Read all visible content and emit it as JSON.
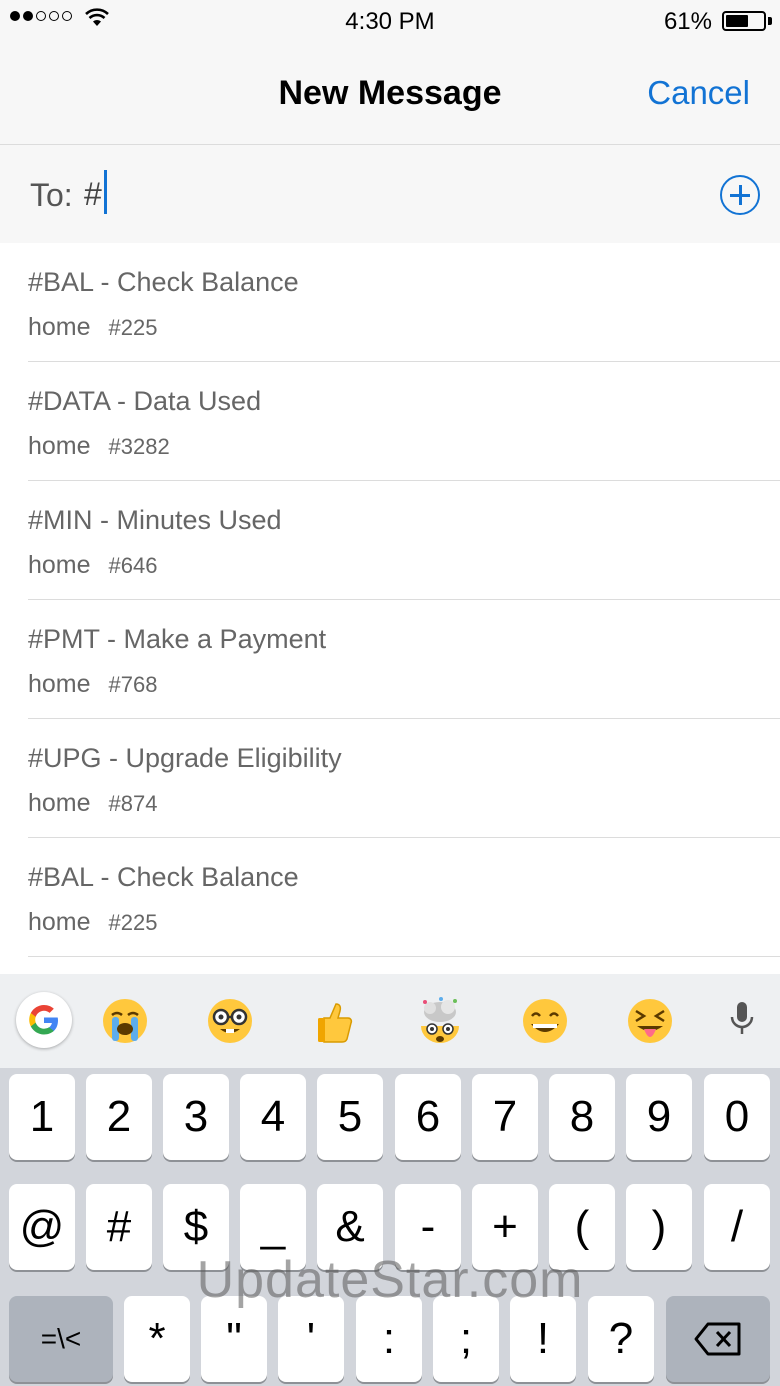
{
  "status": {
    "time": "4:30 PM",
    "battery": "61%"
  },
  "nav": {
    "title": "New Message",
    "cancel": "Cancel"
  },
  "to": {
    "label": "To:",
    "value": "#"
  },
  "contacts": [
    {
      "name": "#BAL - Check Balance",
      "type": "home",
      "number": "#225"
    },
    {
      "name": "#DATA - Data Used",
      "type": "home",
      "number": "#3282"
    },
    {
      "name": "#MIN - Minutes Used",
      "type": "home",
      "number": "#646"
    },
    {
      "name": "#PMT - Make a Payment",
      "type": "home",
      "number": "#768"
    },
    {
      "name": "#UPG - Upgrade Eligibility",
      "type": "home",
      "number": "#874"
    },
    {
      "name": "#BAL - Check Balance",
      "type": "home",
      "number": "#225"
    }
  ],
  "keyboard": {
    "suggestions": [
      "crying-face",
      "nerd-face",
      "thumbs-up",
      "exploding-head",
      "grinning-face",
      "squinting-tongue-face"
    ],
    "row1": [
      "1",
      "2",
      "3",
      "4",
      "5",
      "6",
      "7",
      "8",
      "9",
      "0"
    ],
    "row2": [
      "@",
      "#",
      "$",
      "_",
      "&",
      "-",
      "+",
      "(",
      ")",
      "/"
    ],
    "row3_left": "=\\<",
    "row3": [
      "*",
      "\"",
      "'",
      ":",
      ";",
      "!",
      "?"
    ]
  },
  "watermark": "UpdateStar.com",
  "colors": {
    "accent": "#1273d4"
  }
}
